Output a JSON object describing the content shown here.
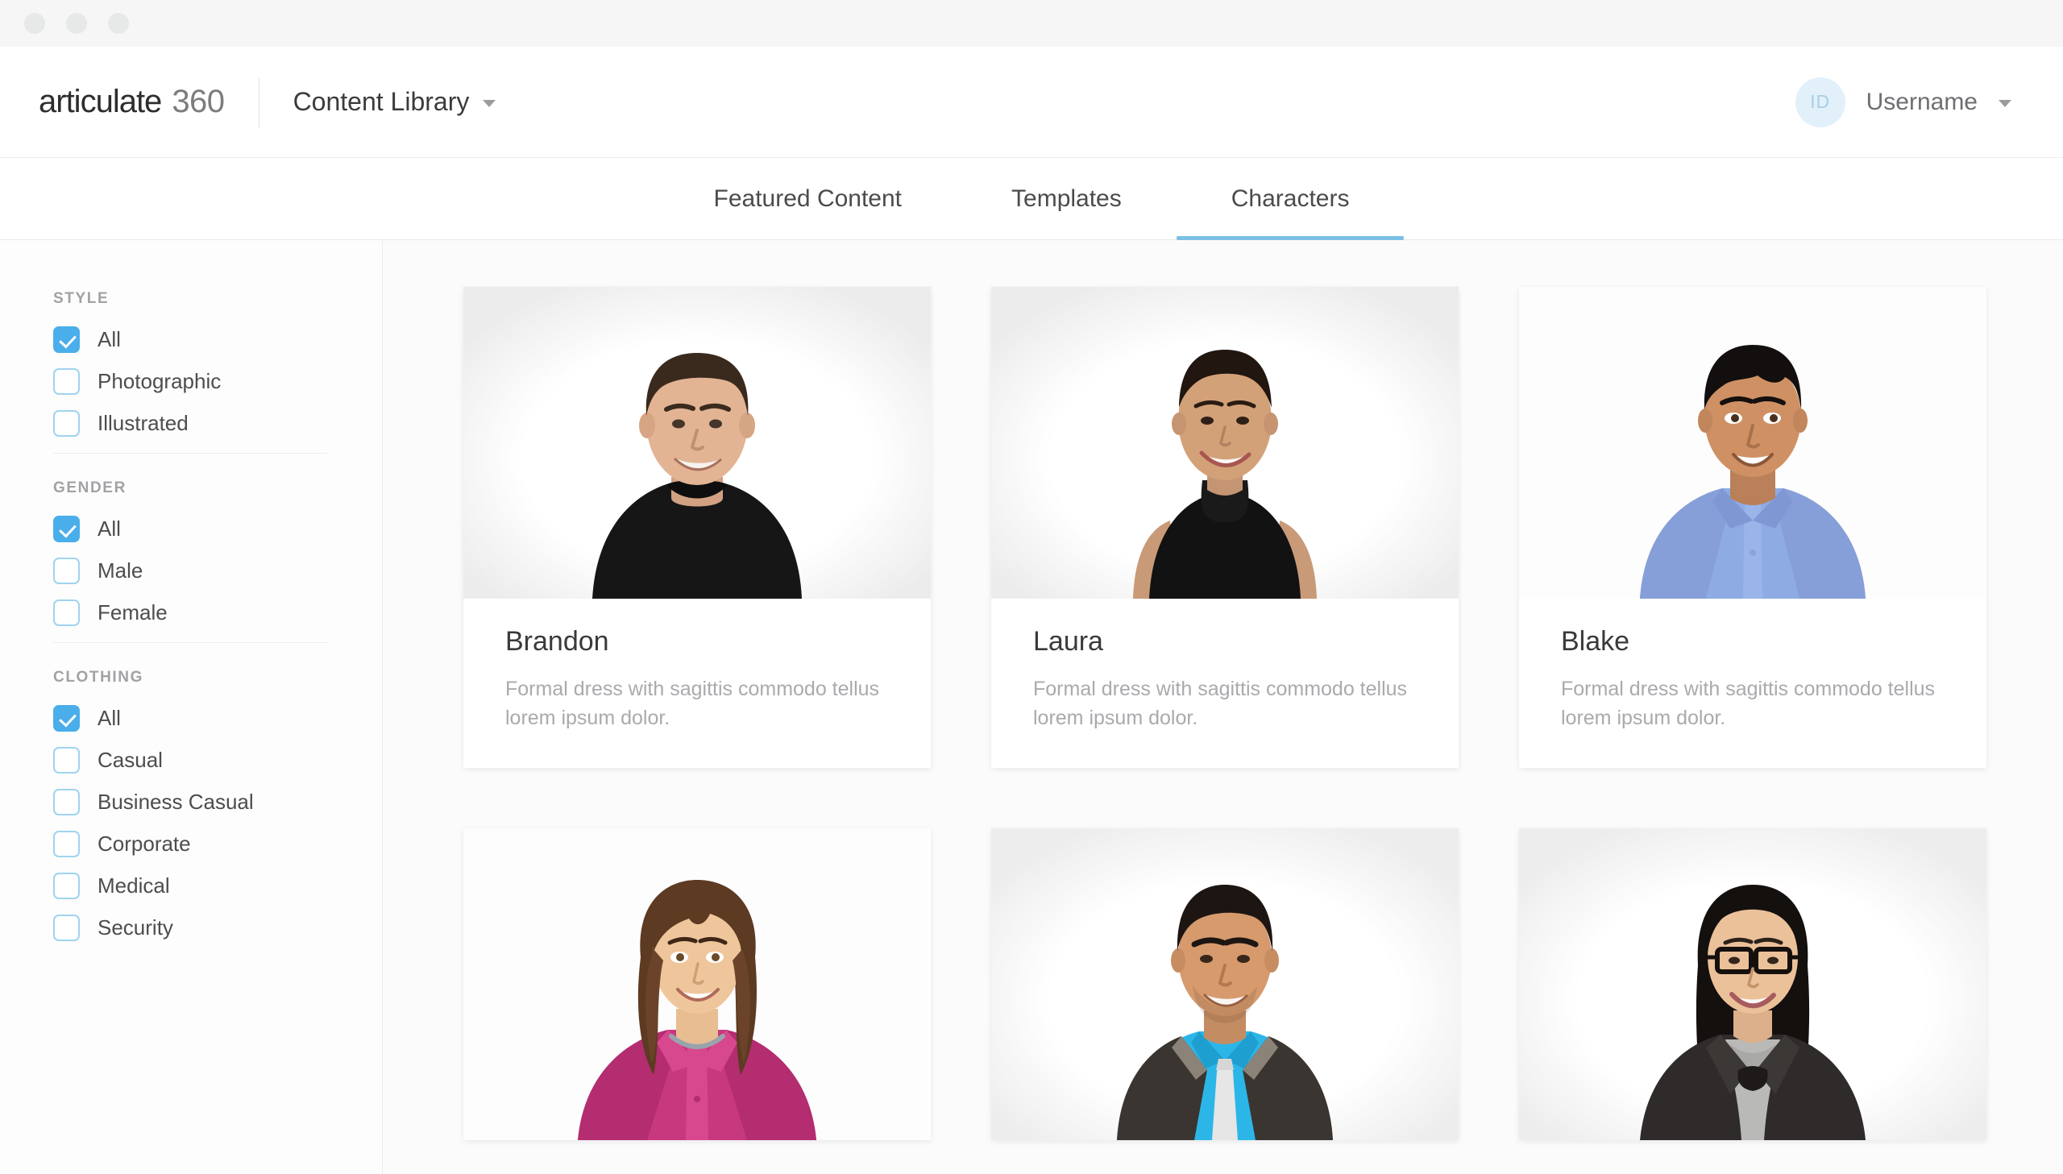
{
  "window": {
    "traffic_lights": [
      "close",
      "minimize",
      "maximize"
    ]
  },
  "header": {
    "brand_primary": "articulate",
    "brand_secondary": "360",
    "library_menu": "Content Library",
    "avatar_initials": "ID",
    "username": "Username"
  },
  "tabs": [
    {
      "label": "Featured Content",
      "active": false
    },
    {
      "label": "Templates",
      "active": false
    },
    {
      "label": "Characters",
      "active": true
    }
  ],
  "sidebar": {
    "groups": [
      {
        "title": "STYLE",
        "options": [
          {
            "label": "All",
            "checked": true
          },
          {
            "label": "Photographic",
            "checked": false
          },
          {
            "label": "Illustrated",
            "checked": false
          }
        ]
      },
      {
        "title": "GENDER",
        "options": [
          {
            "label": "All",
            "checked": true
          },
          {
            "label": "Male",
            "checked": false
          },
          {
            "label": "Female",
            "checked": false
          }
        ]
      },
      {
        "title": "CLOTHING",
        "options": [
          {
            "label": "All",
            "checked": true
          },
          {
            "label": "Casual",
            "checked": false
          },
          {
            "label": "Business Casual",
            "checked": false
          },
          {
            "label": "Corporate",
            "checked": false
          },
          {
            "label": "Medical",
            "checked": false
          },
          {
            "label": "Security",
            "checked": false
          }
        ]
      }
    ]
  },
  "cards": [
    {
      "name": "Brandon",
      "description": "Formal dress with sagittis commodo tellus lorem ipsum dolor.",
      "style": "photographic",
      "art": "man-black-tshirt"
    },
    {
      "name": "Laura",
      "description": "Formal dress with sagittis commodo tellus lorem ipsum dolor.",
      "style": "photographic",
      "art": "woman-black-top"
    },
    {
      "name": "Blake",
      "description": "Formal dress with sagittis commodo tellus lorem ipsum dolor.",
      "style": "illustrated",
      "art": "man-blue-shirt"
    },
    {
      "name": "",
      "description": "",
      "style": "illustrated",
      "art": "woman-pink-shirt"
    },
    {
      "name": "",
      "description": "",
      "style": "photographic",
      "art": "man-vest-tie"
    },
    {
      "name": "",
      "description": "",
      "style": "photographic",
      "art": "woman-glasses-blazer"
    }
  ],
  "colors": {
    "accent": "#4aaeea",
    "tab_underline": "#7cc0e5",
    "checkbox_border": "#9fd4ef",
    "page_background": "#fbfbfb",
    "titlebar": "#f6f6f6"
  }
}
